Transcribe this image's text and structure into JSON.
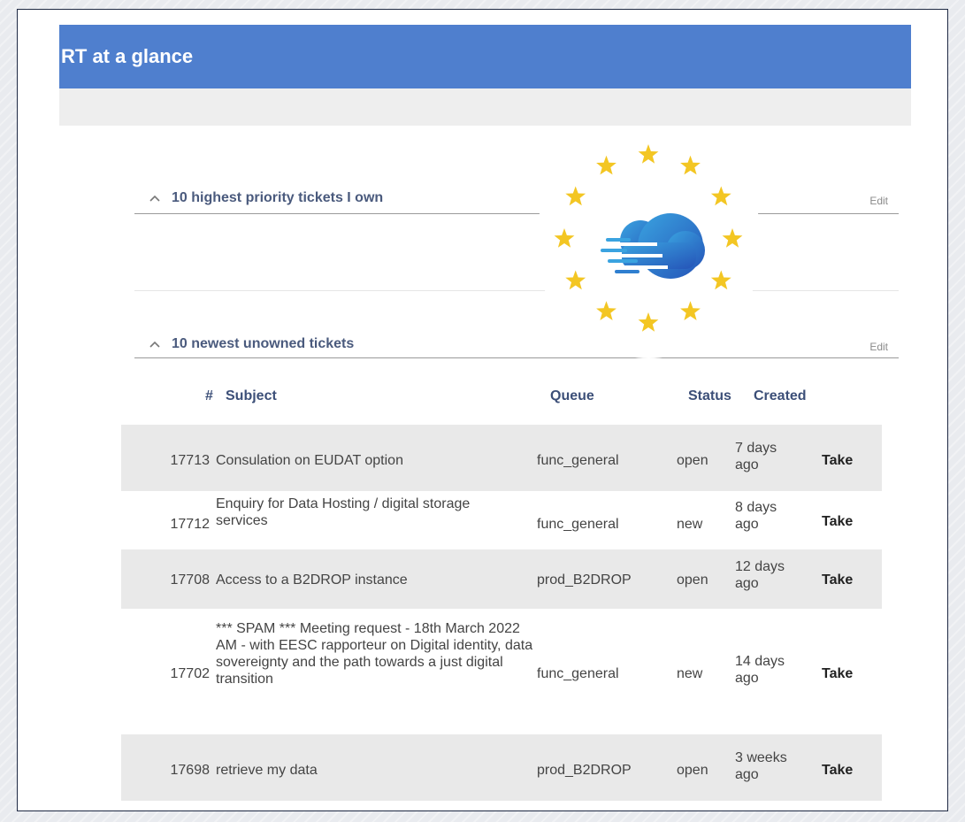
{
  "page": {
    "title": "RT at a glance"
  },
  "sections": [
    {
      "title": "10 highest priority tickets I own",
      "edit": "Edit"
    },
    {
      "title": "10 newest unowned tickets",
      "edit": "Edit"
    }
  ],
  "table": {
    "headers": {
      "id": "#",
      "subject": "Subject",
      "queue": "Queue",
      "status": "Status",
      "created": "Created"
    },
    "rows": [
      {
        "id": "17713",
        "subject": "Consulation on EUDAT option",
        "queue": "func_general",
        "status": "open",
        "created": "7 days ago",
        "action": "Take"
      },
      {
        "id": "17712",
        "subject": "Enquiry for Data Hosting / digital storage services",
        "queue": "func_general",
        "status": "new",
        "created": "8 days ago",
        "action": "Take"
      },
      {
        "id": "17708",
        "subject": "Access to a B2DROP instance",
        "queue": "prod_B2DROP",
        "status": "open",
        "created": "12 days ago",
        "action": "Take"
      },
      {
        "id": "17702",
        "subject": "*** SPAM *** Meeting request - 18th March 2022 AM - with EESC rapporteur on Digital identity, data sovereignty and the path towards a just digital transition",
        "queue": "func_general",
        "status": "new",
        "created": "14 days ago",
        "action": "Take"
      },
      {
        "id": "17698",
        "subject": "retrieve my data",
        "queue": "prod_B2DROP",
        "status": "open",
        "created": "3 weeks ago",
        "action": "Take"
      }
    ]
  },
  "logo": {
    "icon": "eu-cloud-logo-icon",
    "star_color": "#f3c623",
    "cloud_color_start": "#3aa3e0",
    "cloud_color_end": "#2554b8"
  }
}
